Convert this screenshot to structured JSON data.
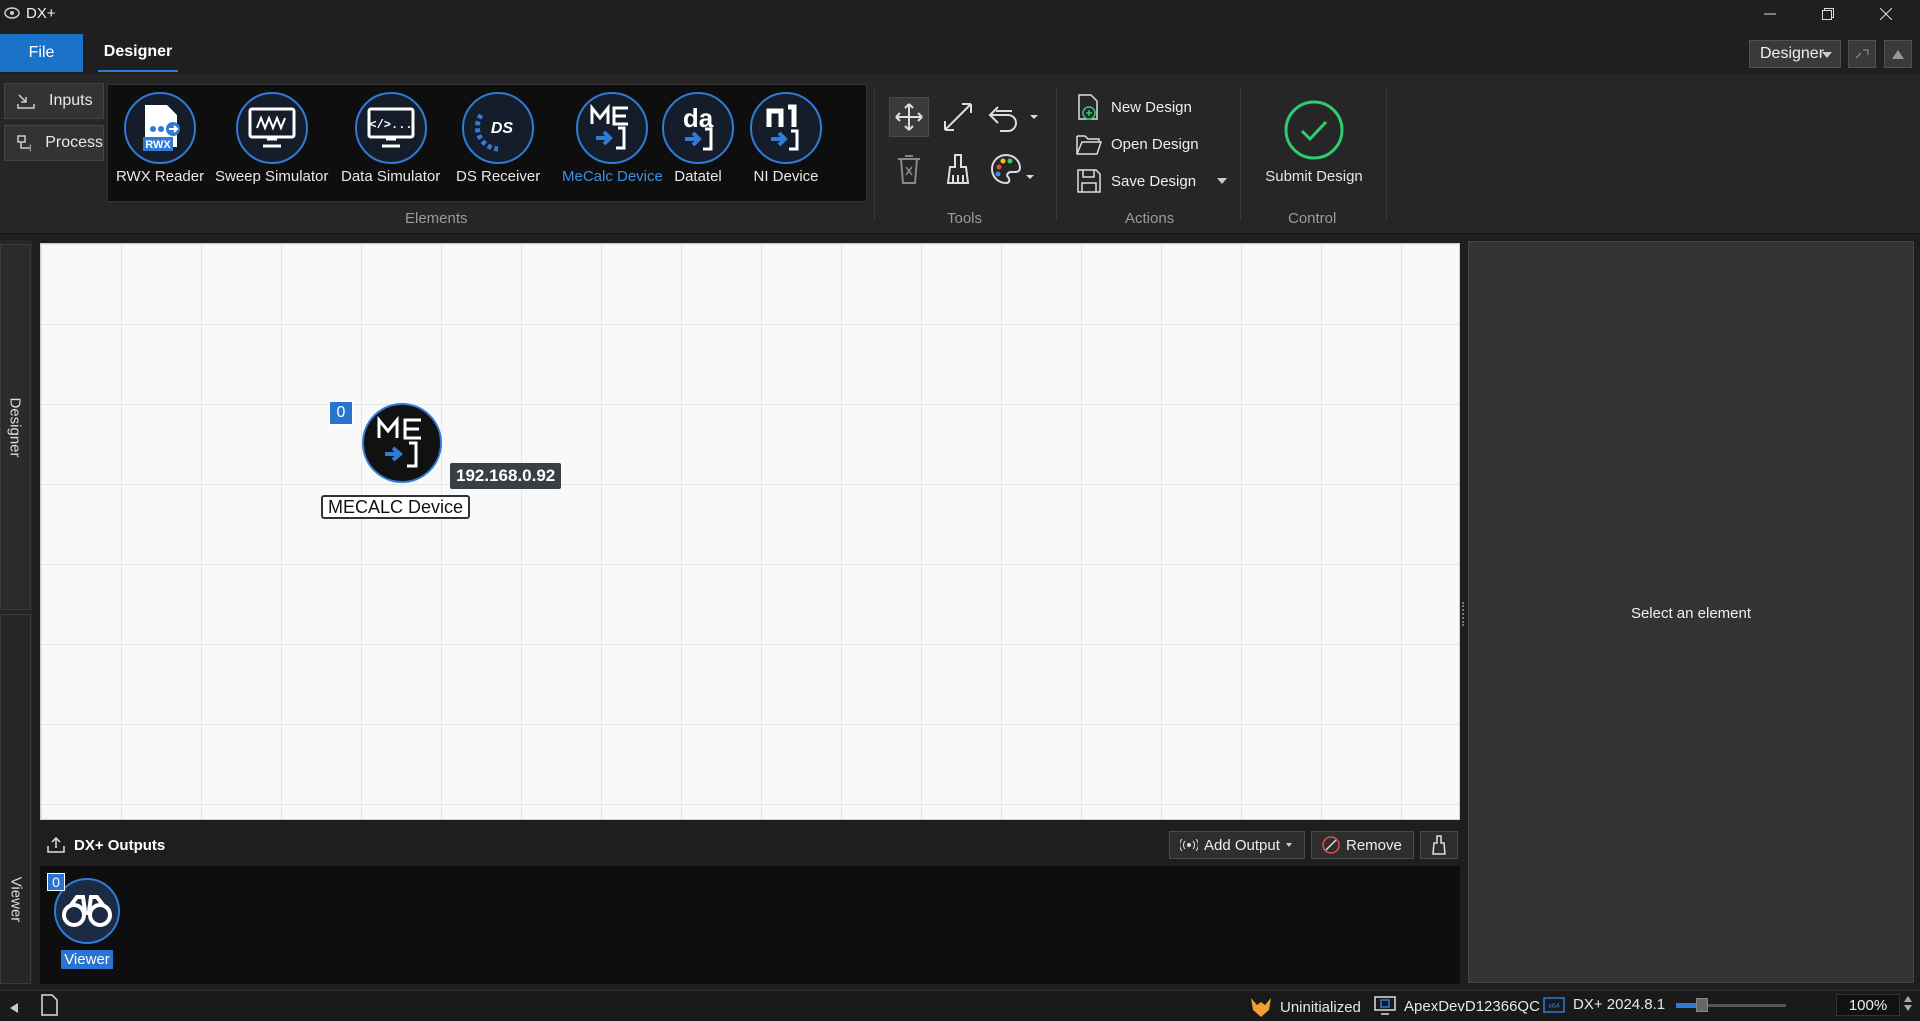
{
  "window": {
    "title": "DX+"
  },
  "ribbon": {
    "file_tab": "File",
    "designer_tab": "Designer",
    "mode_select": "Designer",
    "side_buttons": {
      "inputs": "Inputs",
      "process": "Process"
    },
    "elements": [
      {
        "label": "RWX Reader",
        "icon": "rwx-file-icon"
      },
      {
        "label": "Sweep Simulator",
        "icon": "sweep-monitor-icon"
      },
      {
        "label": "Data Simulator",
        "icon": "code-monitor-icon"
      },
      {
        "label": "DS Receiver",
        "icon": "ds-receiver-icon"
      },
      {
        "label": "MeCalc Device",
        "icon": "mecalc-icon",
        "active": true
      },
      {
        "label": "Datatel",
        "icon": "datatel-icon"
      },
      {
        "label": "NI Device",
        "icon": "ni-device-icon"
      }
    ],
    "groups": {
      "elements": "Elements",
      "tools": "Tools",
      "actions": "Actions",
      "control": "Control"
    },
    "actions": {
      "new": "New Design",
      "open": "Open Design",
      "save": "Save Design"
    },
    "control": {
      "submit": "Submit Design"
    }
  },
  "left_tabs": {
    "designer": "Designer",
    "viewer": "Viewer"
  },
  "canvas": {
    "node": {
      "badge": "0",
      "ip": "192.168.0.92",
      "label": "MECALC Device"
    }
  },
  "right_panel": {
    "placeholder": "Select an element"
  },
  "outputs": {
    "title": "DX+ Outputs",
    "add_output": "Add Output",
    "remove": "Remove",
    "viewer": {
      "badge": "0",
      "label": "Viewer"
    }
  },
  "status": {
    "state": "Uninitialized",
    "machine": "ApexDevD12366QC",
    "version": "DX+ 2024.8.1",
    "zoom": "100%",
    "zoom_fraction": 0.18
  },
  "colors": {
    "accent": "#2f7bd6",
    "file_tab": "#1a73c9",
    "success": "#2ecc71",
    "warning": "#f0a030"
  }
}
